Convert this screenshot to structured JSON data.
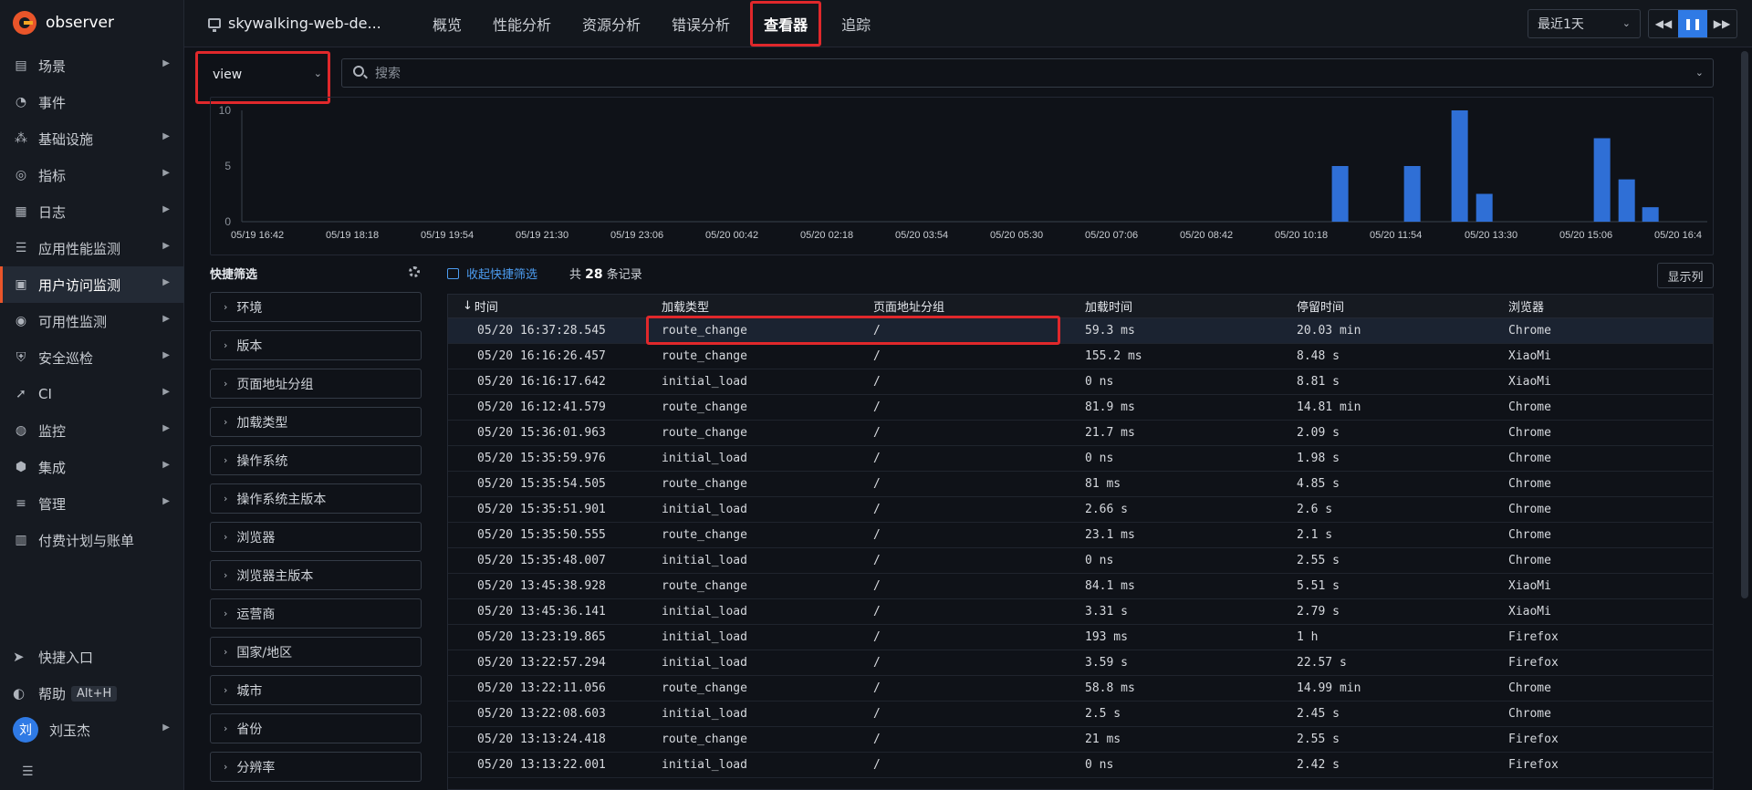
{
  "app": {
    "name": "observer"
  },
  "sidebar": {
    "items": [
      {
        "label": "场景",
        "icon": "scene-icon",
        "glyph": "▤",
        "has_arrow": true
      },
      {
        "label": "事件",
        "icon": "bell-icon",
        "glyph": "◔",
        "has_arrow": false
      },
      {
        "label": "基础设施",
        "icon": "infrastructure-icon",
        "glyph": "⁂",
        "has_arrow": true
      },
      {
        "label": "指标",
        "icon": "metrics-icon",
        "glyph": "◎",
        "has_arrow": true
      },
      {
        "label": "日志",
        "icon": "log-icon",
        "glyph": "▦",
        "has_arrow": true
      },
      {
        "label": "应用性能监测",
        "icon": "apm-icon",
        "glyph": "☰",
        "has_arrow": true
      },
      {
        "label": "用户访问监测",
        "icon": "rum-icon",
        "glyph": "▣",
        "has_arrow": true,
        "active": true
      },
      {
        "label": "可用性监测",
        "icon": "availability-icon",
        "glyph": "◉",
        "has_arrow": true
      },
      {
        "label": "安全巡检",
        "icon": "shield-icon",
        "glyph": "⛨",
        "has_arrow": true
      },
      {
        "label": "CI",
        "icon": "rocket-icon",
        "glyph": "➚",
        "has_arrow": true
      },
      {
        "label": "监控",
        "icon": "monitor-icon",
        "glyph": "◍",
        "has_arrow": true
      },
      {
        "label": "集成",
        "icon": "integration-icon",
        "glyph": "⬢",
        "has_arrow": true
      },
      {
        "label": "管理",
        "icon": "settings-sliders-icon",
        "glyph": "≡",
        "has_arrow": true
      },
      {
        "label": "付费计划与账单",
        "icon": "billing-icon",
        "glyph": "▥",
        "has_arrow": false
      }
    ],
    "bottom": {
      "shortcut": "快捷入口",
      "help": "帮助",
      "help_kbd": "Alt+H",
      "user_initial": "刘",
      "user_name": "刘玉杰"
    }
  },
  "topbar": {
    "app_title": "skywalking-web-de...",
    "tabs": [
      "概览",
      "性能分析",
      "资源分析",
      "错误分析",
      "查看器",
      "追踪"
    ],
    "active_tab": 4,
    "time_range": "最近1天"
  },
  "filter": {
    "view_value": "view",
    "search_placeholder": "搜索"
  },
  "chart_data": {
    "type": "bar",
    "y_ticks": [
      0,
      5,
      10
    ],
    "ylim": [
      0,
      10
    ],
    "x_tick_labels": [
      "05/19 16:42",
      "05/19 18:18",
      "05/19 19:54",
      "05/19 21:30",
      "05/19 23:06",
      "05/20 00:42",
      "05/20 02:18",
      "05/20 03:54",
      "05/20 05:30",
      "05/20 07:06",
      "05/20 08:42",
      "05/20 10:18",
      "05/20 11:54",
      "05/20 13:30",
      "05/20 15:06",
      "05/20 16:4"
    ],
    "bars": [
      {
        "x_tick_index": 11.4,
        "value": 5
      },
      {
        "x_tick_index": 12.16,
        "value": 5
      },
      {
        "x_tick_index": 12.66,
        "value": 10
      },
      {
        "x_tick_index": 12.92,
        "value": 2.5
      },
      {
        "x_tick_index": 14.16,
        "value": 7.5
      },
      {
        "x_tick_index": 14.42,
        "value": 3.8
      },
      {
        "x_tick_index": 14.67,
        "value": 1.3
      }
    ],
    "bar_color": "#2f6fd6"
  },
  "quick_filter": {
    "title": "快捷筛选",
    "items": [
      "环境",
      "版本",
      "页面地址分组",
      "加载类型",
      "操作系统",
      "操作系统主版本",
      "浏览器",
      "浏览器主版本",
      "运营商",
      "国家/地区",
      "城市",
      "省份",
      "分辨率"
    ]
  },
  "table_bar": {
    "collapse_label": "收起快捷筛选",
    "count_prefix": "共",
    "count_value": "28",
    "count_suffix": "条记录",
    "show_columns": "显示列"
  },
  "table": {
    "sort_arrow": "↓",
    "headers": [
      "时间",
      "加载类型",
      "页面地址分组",
      "加载时间",
      "停留时间",
      "浏览器"
    ],
    "rows": [
      [
        "05/20 16:37:28.545",
        "route_change",
        "/",
        "59.3 ms",
        "20.03 min",
        "Chrome"
      ],
      [
        "05/20 16:16:26.457",
        "route_change",
        "/",
        "155.2 ms",
        "8.48 s",
        "XiaoMi"
      ],
      [
        "05/20 16:16:17.642",
        "initial_load",
        "/",
        "0 ns",
        "8.81 s",
        "XiaoMi"
      ],
      [
        "05/20 16:12:41.579",
        "route_change",
        "/",
        "81.9 ms",
        "14.81 min",
        "Chrome"
      ],
      [
        "05/20 15:36:01.963",
        "route_change",
        "/",
        "21.7 ms",
        "2.09 s",
        "Chrome"
      ],
      [
        "05/20 15:35:59.976",
        "initial_load",
        "/",
        "0 ns",
        "1.98 s",
        "Chrome"
      ],
      [
        "05/20 15:35:54.505",
        "route_change",
        "/",
        "81 ms",
        "4.85 s",
        "Chrome"
      ],
      [
        "05/20 15:35:51.901",
        "initial_load",
        "/",
        "2.66 s",
        "2.6 s",
        "Chrome"
      ],
      [
        "05/20 15:35:50.555",
        "route_change",
        "/",
        "23.1 ms",
        "2.1 s",
        "Chrome"
      ],
      [
        "05/20 15:35:48.007",
        "initial_load",
        "/",
        "0 ns",
        "2.55 s",
        "Chrome"
      ],
      [
        "05/20 13:45:38.928",
        "route_change",
        "/",
        "84.1 ms",
        "5.51 s",
        "XiaoMi"
      ],
      [
        "05/20 13:45:36.141",
        "initial_load",
        "/",
        "3.31 s",
        "2.79 s",
        "XiaoMi"
      ],
      [
        "05/20 13:23:19.865",
        "initial_load",
        "/",
        "193 ms",
        "1 h",
        "Firefox"
      ],
      [
        "05/20 13:22:57.294",
        "initial_load",
        "/",
        "3.59 s",
        "22.57 s",
        "Firefox"
      ],
      [
        "05/20 13:22:11.056",
        "route_change",
        "/",
        "58.8 ms",
        "14.99 min",
        "Chrome"
      ],
      [
        "05/20 13:22:08.603",
        "initial_load",
        "/",
        "2.5 s",
        "2.45 s",
        "Chrome"
      ],
      [
        "05/20 13:13:24.418",
        "route_change",
        "/",
        "21 ms",
        "2.55 s",
        "Firefox"
      ],
      [
        "05/20 13:13:22.001",
        "initial_load",
        "/",
        "0 ns",
        "2.42 s",
        "Firefox"
      ]
    ]
  }
}
